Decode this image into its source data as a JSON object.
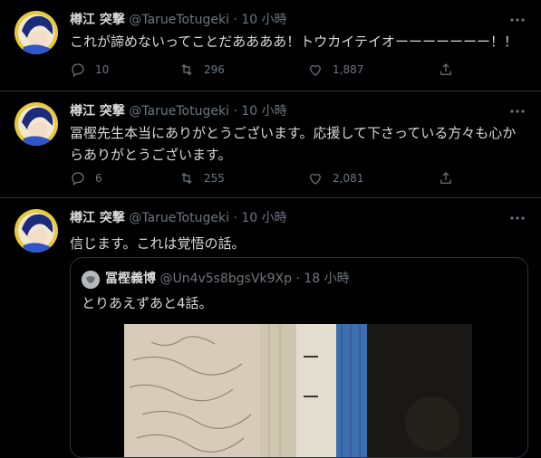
{
  "tweets": [
    {
      "name": "樽江 突撃",
      "handle": "@TarueTotugeki",
      "dot": "·",
      "time": "10 小時",
      "text": "これが諦めないってことだああああ！トウカイテイオーーーーーーー！！",
      "replies": "10",
      "retweets": "296",
      "likes": "1,887"
    },
    {
      "name": "樽江 突撃",
      "handle": "@TarueTotugeki",
      "dot": "·",
      "time": "10 小時",
      "text_line1": "冨樫先生本当にありがとうございます。応援して下さっている方々も心か",
      "text_line2": "らありがとうございます。",
      "replies": "6",
      "retweets": "255",
      "likes": "2,081"
    },
    {
      "name": "樽江 突撃",
      "handle": "@TarueTotugeki",
      "dot": "·",
      "time": "10 小時",
      "text": "信じます。これは覚悟の話。",
      "quote": {
        "name": "冨樫義博",
        "handle": "@Un4v5s8bgsVk9Xp",
        "dot": "·",
        "time": "18 小時",
        "text": "とりあえずあと4話。"
      }
    }
  ],
  "icons": {
    "more": "more-horizontal-icon",
    "reply": "reply-icon",
    "retweet": "retweet-icon",
    "like": "heart-icon",
    "share": "share-icon"
  },
  "colors": {
    "background": "#000000",
    "text": "#d9d9d9",
    "muted": "#6e767d",
    "divider": "#2f3336"
  }
}
